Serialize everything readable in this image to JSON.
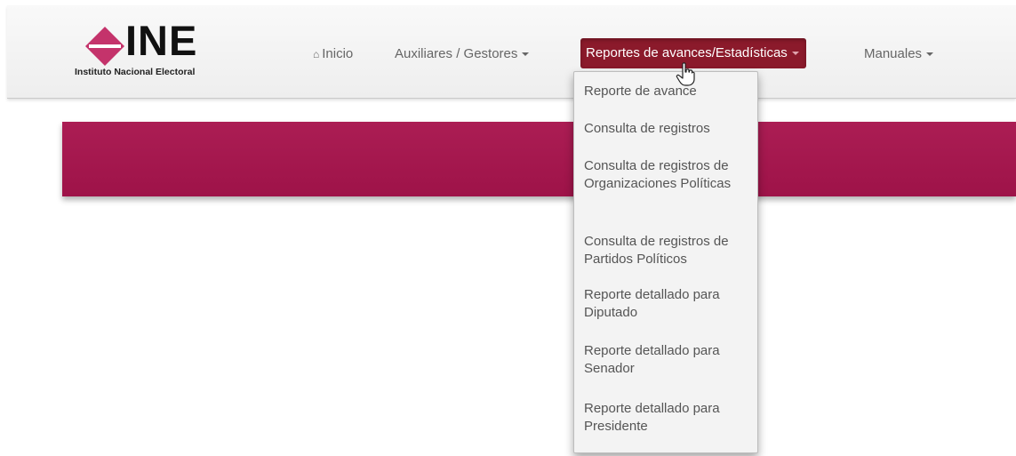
{
  "logo": {
    "name": "INE",
    "subtitle": "Instituto Nacional Electoral",
    "colors": {
      "diamond": "#c4336b",
      "text": "#111111"
    }
  },
  "nav": {
    "home_icon": "home-icon",
    "home": "Inicio",
    "auxiliares": "Auxiliares / Gestores",
    "reportes": "Reportes de avances/Estadísticas",
    "manuales": "Manuales"
  },
  "dropdown": {
    "items": [
      {
        "label": "Reporte de avance"
      },
      {
        "label": "Consulta de registros"
      },
      {
        "label": "Consulta de registros de Organizaciones Políticas"
      },
      {
        "label": "Consulta de registros de Partidos Políticos"
      },
      {
        "label": "Reporte detallado para Diputado"
      },
      {
        "label": "Reporte detallado para Senador"
      },
      {
        "label": "Reporte detallado para Presidente"
      }
    ]
  },
  "colors": {
    "banner": "#a8144d",
    "active_tab": "#8b1a2b",
    "menu_bg": "#f3f3f3",
    "nav_text": "#666666"
  }
}
